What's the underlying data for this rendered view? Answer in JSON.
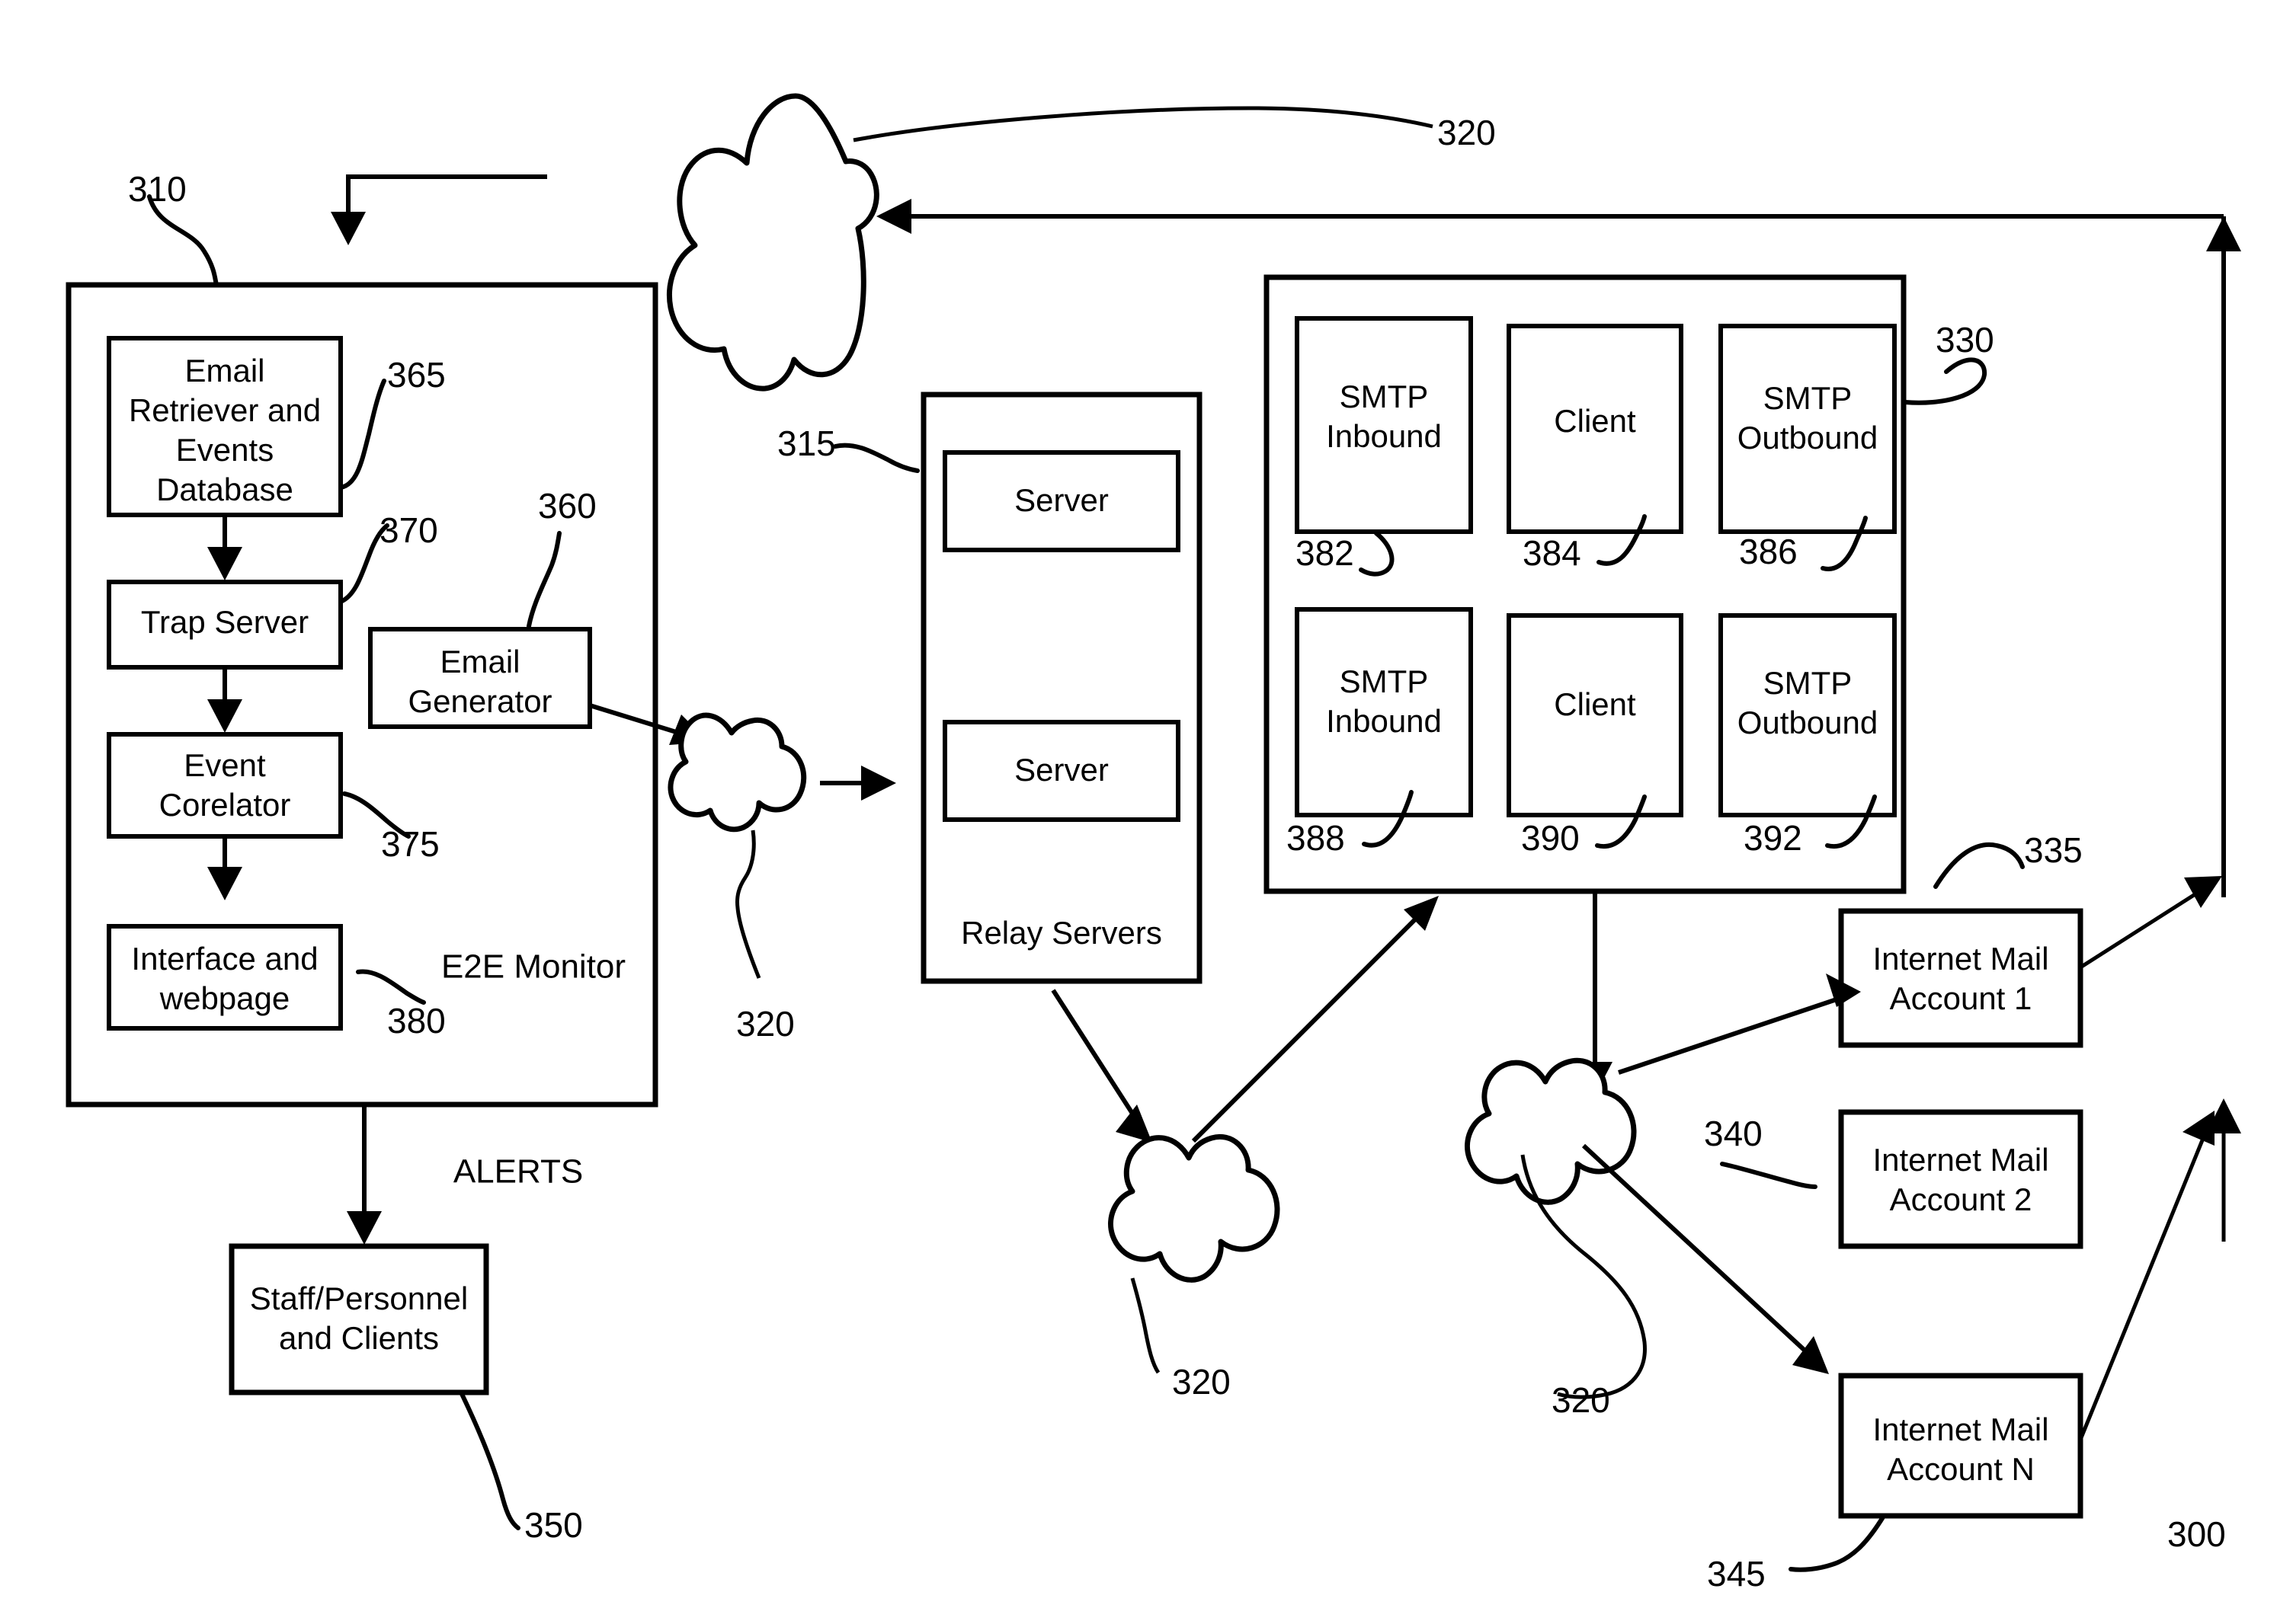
{
  "figure": {
    "title": "Email end-to-end monitoring system block diagram",
    "overall_ref": "300"
  },
  "monitor": {
    "outer_label": "E2E Monitor",
    "outer_ref": "310",
    "alerts_label": "ALERTS",
    "blocks": [
      {
        "label": "Email Retriever and Events Database",
        "lines": [
          "Email",
          "Retriever and",
          "Events",
          "Database"
        ],
        "ref": "365"
      },
      {
        "label": "Trap Server",
        "lines": [
          "Trap Server"
        ],
        "ref": "370"
      },
      {
        "label": "Event Corelator",
        "lines": [
          "Event",
          "Corelator"
        ],
        "ref": "375"
      },
      {
        "label": "Interface and webpage",
        "lines": [
          "Interface and",
          "webpage"
        ],
        "ref": "380"
      },
      {
        "label": "Email Generator",
        "lines": [
          "Email",
          "Generator"
        ],
        "ref": "360"
      }
    ]
  },
  "staff": {
    "lines": [
      "Staff/Personnel",
      "and Clients"
    ],
    "ref": "350"
  },
  "relay": {
    "title": "Relay Servers",
    "ref": "315",
    "servers": [
      {
        "label": "Server"
      },
      {
        "label": "Server"
      }
    ]
  },
  "mail_system": {
    "ref": "330",
    "cells": [
      {
        "lines": [
          "SMTP",
          "Inbound"
        ],
        "ref": "382"
      },
      {
        "lines": [
          "Client"
        ],
        "ref": "384"
      },
      {
        "lines": [
          "SMTP",
          "Outbound"
        ],
        "ref": "386"
      },
      {
        "lines": [
          "SMTP",
          "Inbound"
        ],
        "ref": "388"
      },
      {
        "lines": [
          "Client"
        ],
        "ref": "390"
      },
      {
        "lines": [
          "SMTP",
          "Outbound"
        ],
        "ref": "392"
      }
    ]
  },
  "accounts": [
    {
      "lines": [
        "Internet Mail",
        "Account 1"
      ],
      "ref": "335"
    },
    {
      "lines": [
        "Internet Mail",
        "Account 2"
      ],
      "ref": "340"
    },
    {
      "lines": [
        "Internet Mail",
        "Account N"
      ],
      "ref": "345"
    }
  ],
  "clouds": [
    {
      "ref": "320",
      "position": "top"
    },
    {
      "ref": "320",
      "position": "center-left"
    },
    {
      "ref": "320",
      "position": "bottom-center"
    },
    {
      "ref": "320",
      "position": "bottom-right"
    }
  ],
  "colors": {
    "stroke": "#000000",
    "background": "#ffffff"
  }
}
